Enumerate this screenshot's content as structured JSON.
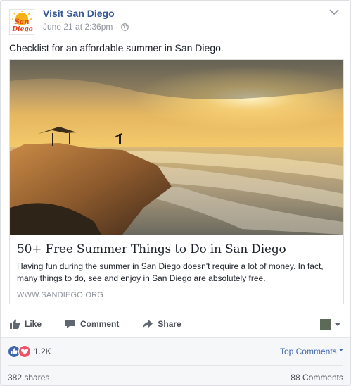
{
  "post": {
    "page_name": "Visit San Diego",
    "timestamp": "June 21 at 2:36pm",
    "separator": "·",
    "text": "Checklist for an affordable summer in San Diego.",
    "logo_text": "San Diego"
  },
  "link": {
    "title": "50+ Free Summer Things to Do in San Diego",
    "description": "Having fun during the summer in San Diego doesn't require a lot of money. In fact, many things to do, see and enjoy in San Diego are absolutely free.",
    "domain": "WWW.SANDIEGO.ORG"
  },
  "actions": {
    "like": "Like",
    "comment": "Comment",
    "share": "Share"
  },
  "stats": {
    "reactions": "1.2K",
    "top_comments": "Top Comments",
    "shares": "382 shares",
    "comments": "88 Comments"
  },
  "colors": {
    "link_blue": "#365899",
    "like_blue": "#4267b2",
    "love_red": "#f25268",
    "muted_gray": "#90949c"
  },
  "icons": [
    "globe-icon",
    "chevron-down-icon",
    "like-icon",
    "comment-icon",
    "share-icon",
    "like-reaction-icon",
    "love-reaction-icon"
  ]
}
